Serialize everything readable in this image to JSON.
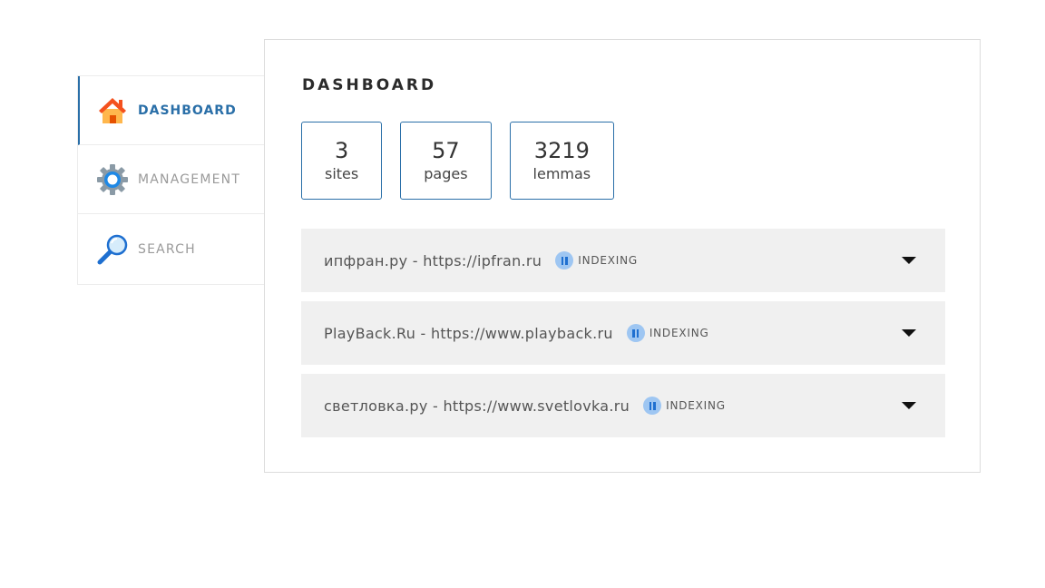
{
  "sidebar": {
    "items": [
      {
        "label": "DASHBOARD",
        "icon": "home-icon",
        "active": true
      },
      {
        "label": "MANAGEMENT",
        "icon": "gear-icon",
        "active": false
      },
      {
        "label": "SEARCH",
        "icon": "magnifier-icon",
        "active": false
      }
    ]
  },
  "main": {
    "title": "DASHBOARD",
    "stats": [
      {
        "value": "3",
        "label": "sites"
      },
      {
        "value": "57",
        "label": "pages"
      },
      {
        "value": "3219",
        "label": "lemmas"
      }
    ],
    "sites": [
      {
        "name": "ипфран.ру - https://ipfran.ru",
        "status": "INDEXING"
      },
      {
        "name": "PlayBack.Ru - https://www.playback.ru",
        "status": "INDEXING"
      },
      {
        "name": "светловка.ру - https://www.svetlovka.ru",
        "status": "INDEXING"
      }
    ]
  },
  "colors": {
    "accent": "#2a6fa8",
    "row_bg": "#f0f0f0",
    "status_icon": "#9ec6f2"
  }
}
